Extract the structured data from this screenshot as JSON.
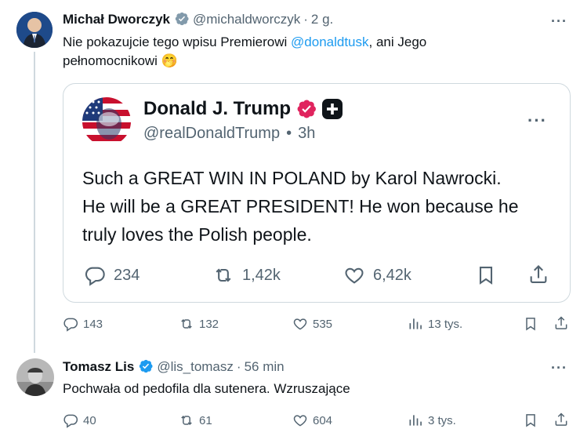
{
  "post": {
    "author_name": "Michał Dworczyk",
    "handle": "@michaldworczyk",
    "sep": "·",
    "time": "2 g.",
    "text_before": "Nie pokazujcie tego wpisu Premierowi ",
    "mention": "@donaldtusk",
    "text_after": ", ani Jego",
    "text_line2": "pełnomocnikowi 🤭",
    "more": "···",
    "actions": {
      "replies": "143",
      "reposts": "132",
      "likes": "535",
      "views": "13 tys."
    }
  },
  "quote": {
    "author_name": "Donald J. Trump",
    "handle": "@realDonaldTrump",
    "sep": "•",
    "time": "3h",
    "more": "···",
    "lines": [
      "Such a GREAT WIN IN POLAND by Karol Nawrocki.",
      "He will be a GREAT PRESIDENT! He won because he",
      "truly loves the Polish people."
    ],
    "actions": {
      "replies": "234",
      "reposts": "1,42k",
      "likes": "6,42k"
    }
  },
  "reply": {
    "author_name": "Tomasz Lis",
    "handle": "@lis_tomasz",
    "sep": "·",
    "time": "56 min",
    "text": "Pochwała od pedofila dla sutenera. Wzruszające",
    "more": "···",
    "actions": {
      "replies": "40",
      "reposts": "61",
      "likes": "604",
      "views": "3 tys."
    }
  },
  "colors": {
    "accent": "#1d9bf0",
    "verified_blue": "#1d9bf0",
    "verified_pink": "#e0245e",
    "text": "#0f1419",
    "secondary": "#536471",
    "border": "#cfd9de"
  },
  "icons": [
    "verified-badge-icon",
    "plus-badge-icon",
    "reply-icon",
    "repost-icon",
    "like-icon",
    "views-icon",
    "bookmark-icon",
    "share-icon",
    "more-icon"
  ]
}
